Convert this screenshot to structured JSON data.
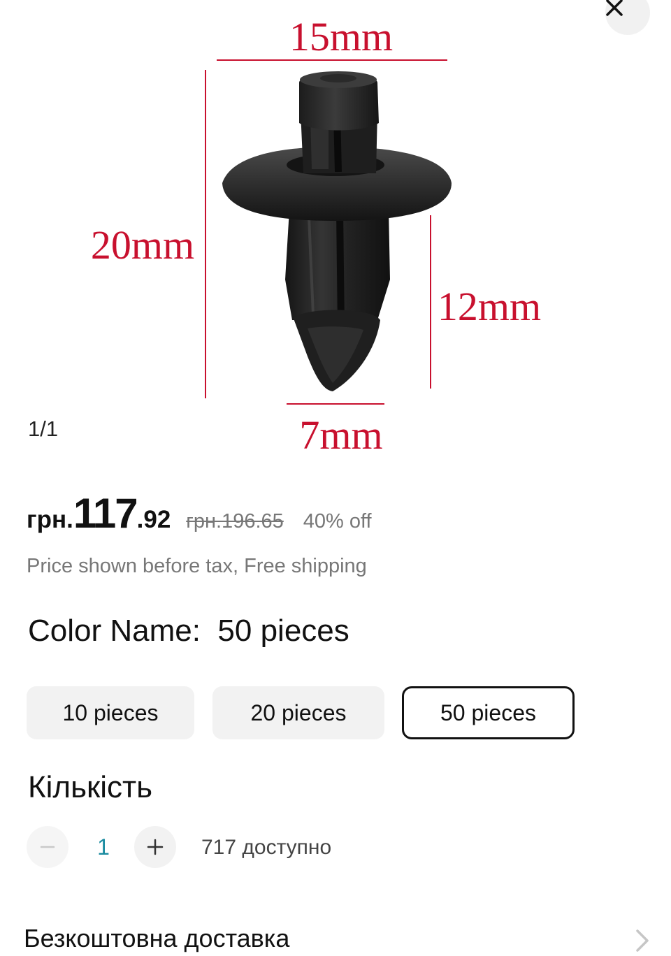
{
  "image": {
    "counter": "1/1",
    "dimensions": {
      "top": "15mm",
      "left": "20mm",
      "right": "12mm",
      "bottom": "7mm"
    },
    "dimension_color": "#c8102e",
    "close_icon": "close-icon"
  },
  "price": {
    "currency": "грн.",
    "main": "117",
    "cents": ".92",
    "original": "грн.196.65",
    "discount": "40% off",
    "note": "Price shown before tax, Free shipping"
  },
  "variant": {
    "heading": "Color Name:  50 pieces",
    "options": [
      {
        "label": "10 pieces",
        "selected": false
      },
      {
        "label": "20 pieces",
        "selected": false
      },
      {
        "label": "50 pieces",
        "selected": true
      }
    ]
  },
  "quantity": {
    "heading": "Кількість",
    "value": "1",
    "available": "717 доступно",
    "minus_icon": "minus-icon",
    "plus_icon": "plus-icon"
  },
  "shipping": {
    "label": "Безкоштовна доставка",
    "icon": "chevron-right-icon"
  },
  "colors": {
    "quantity_value": "#1a8ba0",
    "muted_text": "#777777",
    "selected_border": "#111111"
  }
}
